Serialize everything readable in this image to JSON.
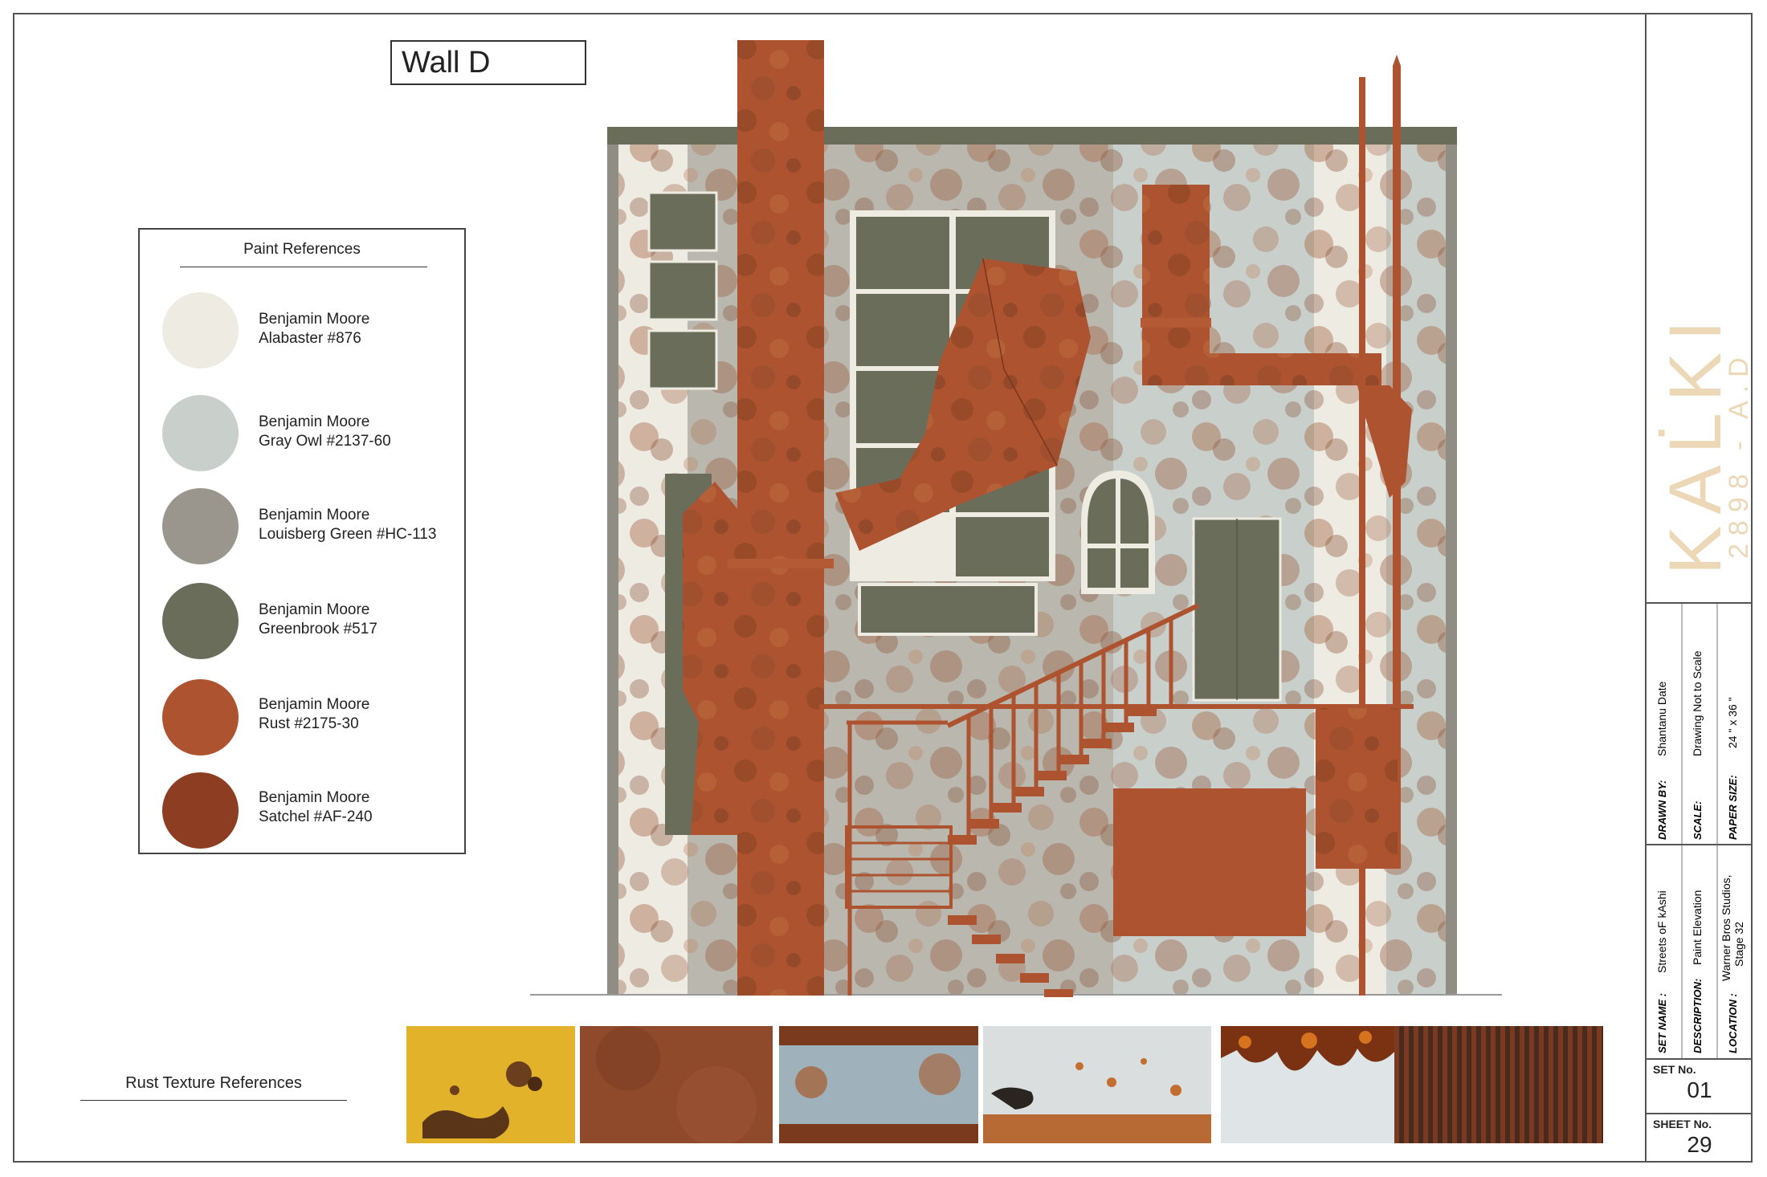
{
  "wall_title": "Wall D",
  "paint_references": {
    "heading": "Paint References",
    "swatches": [
      {
        "brand": "Benjamin Moore",
        "name": "Alabaster #876",
        "color": "#eeebe3"
      },
      {
        "brand": "Benjamin Moore",
        "name": "Gray Owl #2137-60",
        "color": "#c9cfcb"
      },
      {
        "brand": "Benjamin Moore",
        "name": "Louisberg Green #HC-113",
        "color": "#9a968e"
      },
      {
        "brand": "Benjamin Moore",
        "name": "Greenbrook #517",
        "color": "#6b6d5b"
      },
      {
        "brand": "Benjamin Moore",
        "name": "Rust #2175-30",
        "color": "#ad5330"
      },
      {
        "brand": "Benjamin Moore",
        "name": "Satchel #AF-240",
        "color": "#8d3d22"
      }
    ]
  },
  "rust_textures": {
    "heading": "Rust Texture References",
    "swatches": [
      "yellow-peeling-paint",
      "brown-rust-sheet",
      "blue-grey-rust",
      "orange-speckle-rust",
      "white-rust-drip",
      "corrugated-rust"
    ]
  },
  "title_block": {
    "logo_main": "KAL̇KI",
    "logo_sub": "2898 - A.D",
    "drawn_by_label": "DRAWN BY:",
    "drawn_by": "Shantanu Date",
    "scale_label": "SCALE:",
    "scale": "Drawing Not to Scale",
    "paper_size_label": "PAPER SIZE:",
    "paper_size": "24 \" x 36 \"",
    "set_name_label": "SET NAME :",
    "set_name": "Streets oF kAshi",
    "description_label": "DESCRIPTION:",
    "description": "Paint Elevation",
    "location_label": "LOCATION :",
    "location_line1": "Warner Bros Studios,",
    "location_line2": "Stage 32",
    "set_no_label": "SET No.",
    "set_no": "01",
    "sheet_no_label": "SHEET No.",
    "sheet_no": "29"
  },
  "colors": {
    "alabaster": "#eeebe3",
    "gray_owl": "#c9cfcb",
    "louisberg": "#9a968e",
    "greenbrook": "#6b6d5b",
    "rust": "#ad5330",
    "satchel": "#8d3d22",
    "logo": "#ecd8b6"
  }
}
